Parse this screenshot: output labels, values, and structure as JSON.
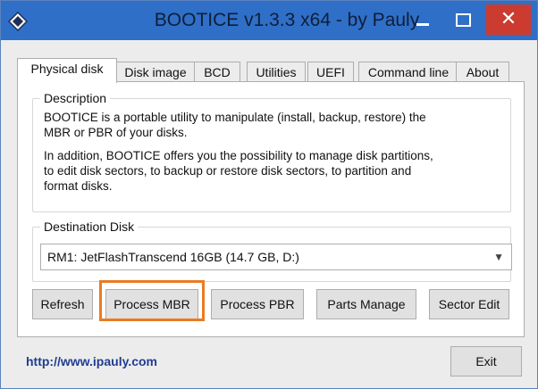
{
  "window": {
    "title": "BOOTICE v1.3.3 x64 - by Pauly",
    "minimize_icon": "minimize-icon",
    "maximize_icon": "maximize-icon",
    "close_label": "✕"
  },
  "tabs": [
    {
      "label": "Physical disk",
      "active": true
    },
    {
      "label": "Disk image",
      "active": false
    },
    {
      "label": "BCD",
      "active": false
    },
    {
      "label": "Utilities",
      "active": false
    },
    {
      "label": "UEFI",
      "active": false
    },
    {
      "label": "Command line",
      "active": false
    },
    {
      "label": "About",
      "active": false
    }
  ],
  "description": {
    "label": "Description",
    "para1_line1": "BOOTICE is a portable utility to manipulate (install, backup, restore) the",
    "para1_line2": "MBR or PBR of your disks.",
    "para2_line1": "In addition, BOOTICE offers you the possibility to manage disk partitions,",
    "para2_line2": "to edit disk sectors, to backup or restore disk sectors, to partition and",
    "para2_line3": "format disks."
  },
  "destination": {
    "label": "Destination Disk",
    "selected": "RM1: JetFlashTranscend 16GB (14.7 GB, D:)",
    "dropdown_icon": "chevron-down-icon"
  },
  "buttons": {
    "refresh": "Refresh",
    "process_mbr": "Process MBR",
    "process_pbr": "Process PBR",
    "parts_manage": "Parts Manage",
    "sector_edit": "Sector Edit"
  },
  "footer": {
    "link": "http://www.ipauly.com",
    "exit": "Exit"
  },
  "colors": {
    "titlebar": "#2f6fc7",
    "close_button": "#cc3b2f",
    "highlight": "#ea7b22",
    "link": "#1f3d93"
  }
}
